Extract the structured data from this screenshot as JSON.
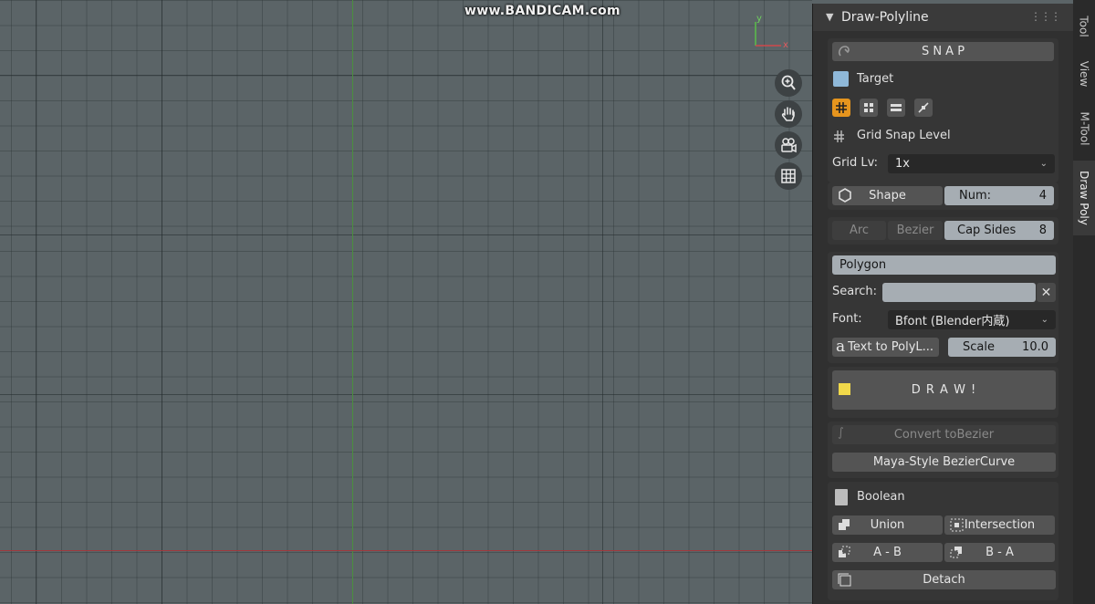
{
  "watermark": "www.BANDICAM.com",
  "gizmo": {
    "x_label": "x",
    "y_label": "y"
  },
  "nav_tools": [
    "zoom-icon",
    "hand-pan-icon",
    "camera-icon",
    "grid-icon"
  ],
  "panel": {
    "title": "Draw-Polyline",
    "snap_label": "S N A P",
    "target_label": "Target",
    "grid_snap_label": "Grid Snap Level",
    "grid_lv_label": "Grid Lv:",
    "grid_lv_value": "1x",
    "shape_label": "Shape",
    "num_label": "Num:",
    "num_value": "4",
    "arc_label": "Arc",
    "bezier_label": "Bezier",
    "cap_sides_label": "Cap Sides",
    "cap_sides_value": "8",
    "polygon_label": "Polygon",
    "search_label": "Search:",
    "search_value": "",
    "font_label": "Font:",
    "font_value": "Bfont (Blender内蔵)",
    "text_to_poly_label": "Text to PolyL...",
    "scale_label": "Scale",
    "scale_value": "10.0",
    "draw_label": "D R A W !",
    "convert_label": "Convert toBezier",
    "maya_label": "Maya-Style BezierCurve",
    "boolean_label": "Boolean",
    "union_label": "Union",
    "intersection_label": "Intersection",
    "a_minus_b_label": "A - B",
    "b_minus_a_label": "B - A",
    "detach_label": "Detach"
  },
  "tabs": [
    "Tool",
    "View",
    "M-Tool",
    "Draw Poly"
  ],
  "colors": {
    "accent": "#e6951e",
    "draw_swatch": "#f0d84a",
    "x_axis": "#a0393d",
    "y_axis": "#4b8f3f"
  }
}
